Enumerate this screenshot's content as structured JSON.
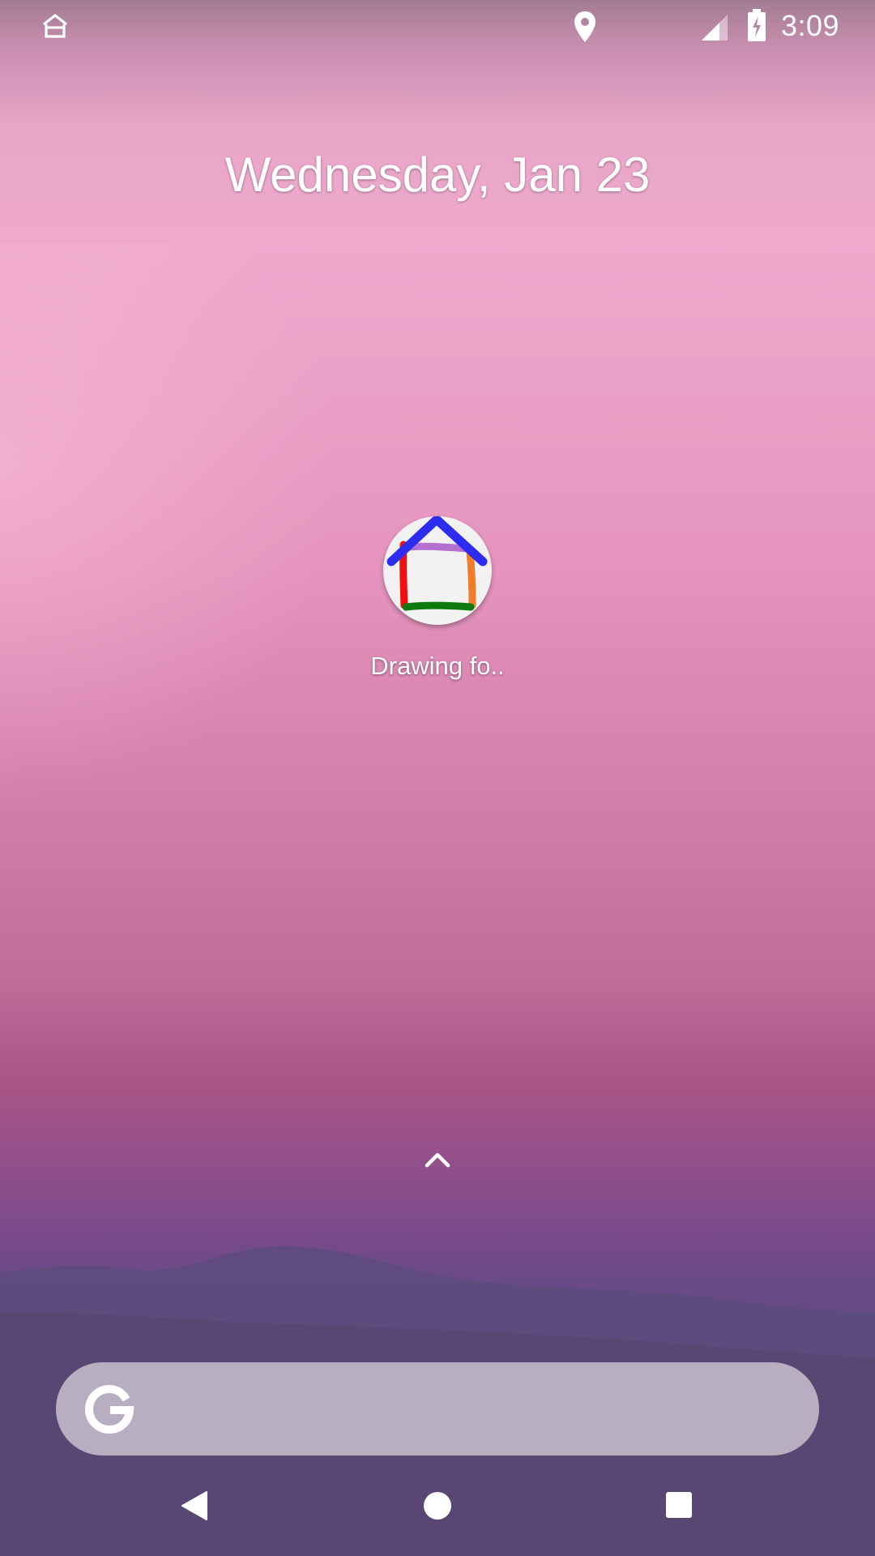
{
  "status_bar": {
    "time": "3:09",
    "icons": [
      "home-outline-icon",
      "location-pin-icon",
      "cell-signal-icon",
      "battery-charging-icon"
    ]
  },
  "home": {
    "date": "Wednesday, Jan 23"
  },
  "apps": [
    {
      "label": "Drawing fo..",
      "icon": "house-drawing-icon"
    }
  ],
  "swipe_hint_icon": "chevron-up-icon",
  "search_bar": {
    "icon": "google-g-icon"
  },
  "nav_bar": {
    "icons": [
      "back-triangle-icon",
      "home-circle-icon",
      "recents-square-icon"
    ]
  },
  "colors": {
    "sky_top": "#efa9cd",
    "sky_bottom": "#7b4a8a",
    "mountain": "#55466c",
    "search_bar": "#d2cdd7"
  }
}
